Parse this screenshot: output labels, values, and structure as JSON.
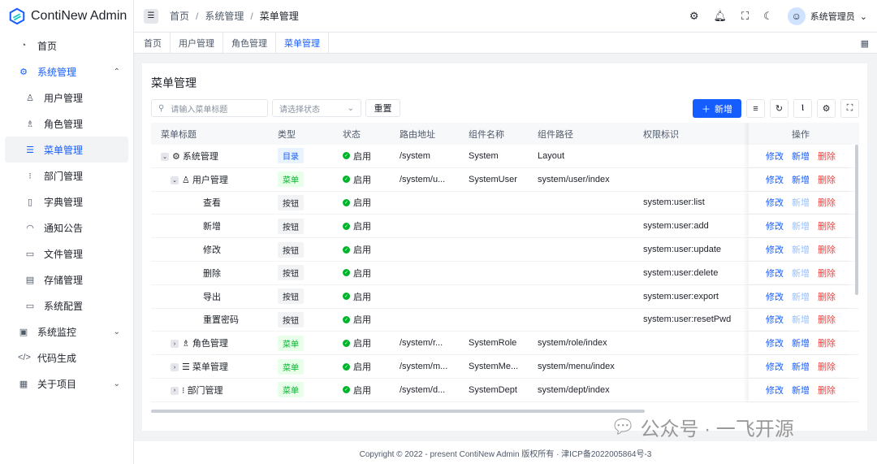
{
  "app": {
    "title": "ContiNew Admin"
  },
  "sidebar": {
    "items": [
      {
        "label": "首页",
        "icon": "dashboard-icon",
        "glyph": "◔",
        "level": 0
      },
      {
        "label": "系统管理",
        "icon": "gear-icon",
        "glyph": "⚙",
        "level": 0,
        "open": true,
        "arrow": "⌃"
      },
      {
        "label": "用户管理",
        "icon": "user-icon",
        "glyph": "♙",
        "level": 1
      },
      {
        "label": "角色管理",
        "icon": "users-icon",
        "glyph": "♗",
        "level": 1
      },
      {
        "label": "菜单管理",
        "icon": "menu-icon",
        "glyph": "☰",
        "level": 1,
        "active": true
      },
      {
        "label": "部门管理",
        "icon": "list-icon",
        "glyph": "⁝",
        "level": 1
      },
      {
        "label": "字典管理",
        "icon": "book-icon",
        "glyph": "▯",
        "level": 1
      },
      {
        "label": "通知公告",
        "icon": "bell-icon",
        "glyph": "◠",
        "level": 1
      },
      {
        "label": "文件管理",
        "icon": "folder-icon",
        "glyph": "▭",
        "level": 1
      },
      {
        "label": "存储管理",
        "icon": "storage-icon",
        "glyph": "▤",
        "level": 1
      },
      {
        "label": "系统配置",
        "icon": "desktop-icon",
        "glyph": "▭",
        "level": 1
      },
      {
        "label": "系统监控",
        "icon": "monitor-icon",
        "glyph": "▣",
        "level": 0,
        "arrow": "⌄"
      },
      {
        "label": "代码生成",
        "icon": "code-icon",
        "glyph": "</>",
        "level": 0
      },
      {
        "label": "关于项目",
        "icon": "apps-icon",
        "glyph": "▦",
        "level": 0,
        "arrow": "⌄"
      }
    ]
  },
  "header": {
    "breadcrumb": [
      "首页",
      "系统管理",
      "菜单管理"
    ],
    "user": "系统管理员"
  },
  "tabs": [
    "首页",
    "用户管理",
    "角色管理",
    "菜单管理"
  ],
  "page": {
    "title": "菜单管理",
    "search_placeholder": "请输入菜单标题",
    "status_placeholder": "请选择状态",
    "reset": "重置",
    "add": "新增"
  },
  "table": {
    "columns": [
      "菜单标题",
      "类型",
      "状态",
      "路由地址",
      "组件名称",
      "组件路径",
      "权限标识",
      "操作"
    ],
    "ops": {
      "edit": "修改",
      "add": "新增",
      "delete": "删除"
    },
    "rows": [
      {
        "title": "系统管理",
        "level": 0,
        "expand": "⌄",
        "icon": "⚙",
        "type": "目录",
        "kind": "dir",
        "status": "启用",
        "route": "/system",
        "name": "System",
        "path": "Layout",
        "perm": ""
      },
      {
        "title": "用户管理",
        "level": 1,
        "expand": "⌄",
        "icon": "♙",
        "type": "菜单",
        "kind": "menu",
        "status": "启用",
        "route": "/system/u...",
        "name": "SystemUser",
        "path": "system/user/index",
        "perm": ""
      },
      {
        "title": "查看",
        "level": 2,
        "type": "按钮",
        "kind": "btn",
        "status": "启用",
        "route": "",
        "name": "",
        "path": "",
        "perm": "system:user:list"
      },
      {
        "title": "新增",
        "level": 2,
        "type": "按钮",
        "kind": "btn",
        "status": "启用",
        "route": "",
        "name": "",
        "path": "",
        "perm": "system:user:add"
      },
      {
        "title": "修改",
        "level": 2,
        "type": "按钮",
        "kind": "btn",
        "status": "启用",
        "route": "",
        "name": "",
        "path": "",
        "perm": "system:user:update"
      },
      {
        "title": "删除",
        "level": 2,
        "type": "按钮",
        "kind": "btn",
        "status": "启用",
        "route": "",
        "name": "",
        "path": "",
        "perm": "system:user:delete"
      },
      {
        "title": "导出",
        "level": 2,
        "type": "按钮",
        "kind": "btn",
        "status": "启用",
        "route": "",
        "name": "",
        "path": "",
        "perm": "system:user:export"
      },
      {
        "title": "重置密码",
        "level": 2,
        "type": "按钮",
        "kind": "btn",
        "status": "启用",
        "route": "",
        "name": "",
        "path": "",
        "perm": "system:user:resetPwd"
      },
      {
        "title": "角色管理",
        "level": 1,
        "expand": "›",
        "icon": "♗",
        "type": "菜单",
        "kind": "menu",
        "status": "启用",
        "route": "/system/r...",
        "name": "SystemRole",
        "path": "system/role/index",
        "perm": ""
      },
      {
        "title": "菜单管理",
        "level": 1,
        "expand": "›",
        "icon": "☰",
        "type": "菜单",
        "kind": "menu",
        "status": "启用",
        "route": "/system/m...",
        "name": "SystemMe...",
        "path": "system/menu/index",
        "perm": ""
      },
      {
        "title": "部门管理",
        "level": 1,
        "expand": "›",
        "icon": "⁝",
        "type": "菜单",
        "kind": "menu",
        "status": "启用",
        "route": "/system/d...",
        "name": "SystemDept",
        "path": "system/dept/index",
        "perm": ""
      }
    ]
  },
  "footer": "Copyright © 2022 - present ContiNew Admin 版权所有 · 津ICP备2022005864号-3",
  "watermark": "公众号 · 一飞开源"
}
